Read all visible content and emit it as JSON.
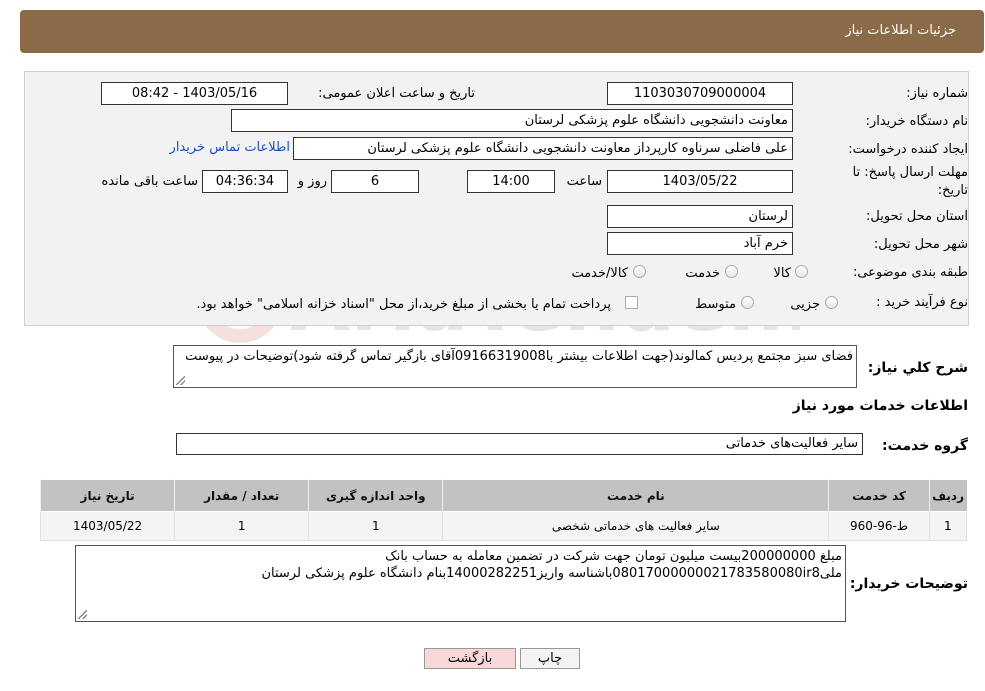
{
  "header": {
    "title": "جزئیات اطلاعات نیاز"
  },
  "form": {
    "need_number_label": "شماره نیاز:",
    "need_number": "1103030709000004",
    "announce_label": "تاریخ و ساعت اعلان عمومی:",
    "announce_value": "1403/05/16 - 08:42",
    "buyer_org_label": "نام دستگاه خریدار:",
    "buyer_org": "معاونت دانشجویی دانشگاه علوم پزشکی لرستان",
    "creator_label": "ایجاد کننده درخواست:",
    "creator": "علی فاضلی سرناوه کارپرداز معاونت دانشجویی دانشگاه علوم پزشکی لرستان",
    "contact_link": "اطلاعات تماس خریدار",
    "deadline_label_1": "مهلت ارسال پاسخ: تا",
    "deadline_label_2": "تاریخ:",
    "deadline_date": "1403/05/22",
    "time_label": "ساعت",
    "deadline_time": "14:00",
    "days_value": "6",
    "days_label": "روز و",
    "remaining_time": "04:36:34",
    "remaining_label": "ساعت باقی مانده",
    "province_label": "استان محل تحویل:",
    "province": "لرستان",
    "city_label": "شهر محل تحویل:",
    "city": "خرم آباد",
    "category_label": "طبقه بندی موضوعی:",
    "category_options": [
      "کالا",
      "خدمت",
      "کالا/خدمت"
    ],
    "purchase_label": "نوع فرآیند خرید :",
    "purchase_options": [
      "جزیی",
      "متوسط"
    ],
    "purchase_note_checkbox": "پرداخت تمام یا بخشی از مبلغ خرید،از محل \"اسناد خزانه اسلامی\" خواهد بود."
  },
  "summary": {
    "label": "شرح کلي نياز:",
    "text": "فضای سبز مجتمع پردیس کمالوند(جهت اطلاعات بیشتر با09166319008آقای بازگیر تماس گرفته شود)توضیحات در پیوست"
  },
  "services": {
    "section_title": "اطلاعات خدمات مورد نياز",
    "group_label": "گروه خدمت:",
    "group_value": "سایر فعالیت‌های خدماتی",
    "columns": [
      "رديف",
      "کد خدمت",
      "نام خدمت",
      "واحد اندازه گيری",
      "تعداد / مقدار",
      "تاريخ نياز"
    ],
    "rows": [
      {
        "row": "1",
        "code": "ط-96-960",
        "name": "سایر فعالیت های خدماتی شخصی",
        "unit": "1",
        "qty": "1",
        "date": "1403/05/22"
      }
    ]
  },
  "buyer_notes": {
    "label": "توضیحات خریدار:",
    "line1": "مبلغ 200000000بیست میلیون تومان جهت شرکت در تضمین معامله به حساب بانک",
    "line2": "ملی08017000000021783580080ir8باشناسه واریز14000282251بنام دانشگاه علوم پزشکی لرستان"
  },
  "buttons": {
    "print": "چاپ",
    "back": "بازگشت"
  },
  "watermark": "AriaTender.neT",
  "colors": {
    "header": "#8b6a47",
    "link": "#1a4fbf",
    "back_button": "#f7d7d7",
    "table_header": "#c2c2c2"
  }
}
